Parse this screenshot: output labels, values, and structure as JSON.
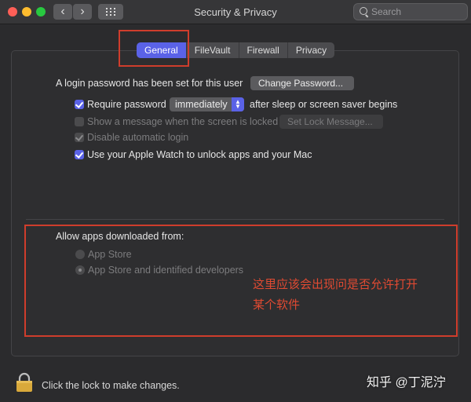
{
  "window": {
    "title": "Security & Privacy",
    "search_placeholder": "Search"
  },
  "toolbar": {
    "back_glyph": "‹",
    "forward_glyph": "›"
  },
  "tabs": [
    {
      "label": "General",
      "active": true
    },
    {
      "label": "FileVault",
      "active": false
    },
    {
      "label": "Firewall",
      "active": false
    },
    {
      "label": "Privacy",
      "active": false
    }
  ],
  "general": {
    "login_text": "A login password has been set for this user",
    "change_password_label": "Change Password...",
    "require_password_label": "Require password",
    "require_password_checked": true,
    "require_password_value": "immediately",
    "after_sleep_text": "after sleep or screen saver begins",
    "show_message_label": "Show a message when the screen is locked",
    "show_message_checked": false,
    "set_lock_message_label": "Set Lock Message...",
    "disable_login_label": "Disable automatic login",
    "disable_login_checked": true,
    "apple_watch_label": "Use your Apple Watch to unlock apps and your Mac",
    "apple_watch_checked": true
  },
  "allow_apps": {
    "heading": "Allow apps downloaded from:",
    "options": [
      {
        "label": "App Store",
        "selected": false
      },
      {
        "label": "App Store and identified developers",
        "selected": true
      }
    ]
  },
  "annotation": {
    "line1": "这里应该会出现问是否允许打开",
    "line2": "某个软件",
    "color": "#cf3d2c"
  },
  "footer": {
    "lock_text": "Click the lock to make changes."
  },
  "watermark": {
    "text": "知乎 @丁泥泞"
  },
  "colors": {
    "accent": "#5a62e7",
    "window_bg": "#2b2b2d",
    "lock": "#d9a93b"
  }
}
